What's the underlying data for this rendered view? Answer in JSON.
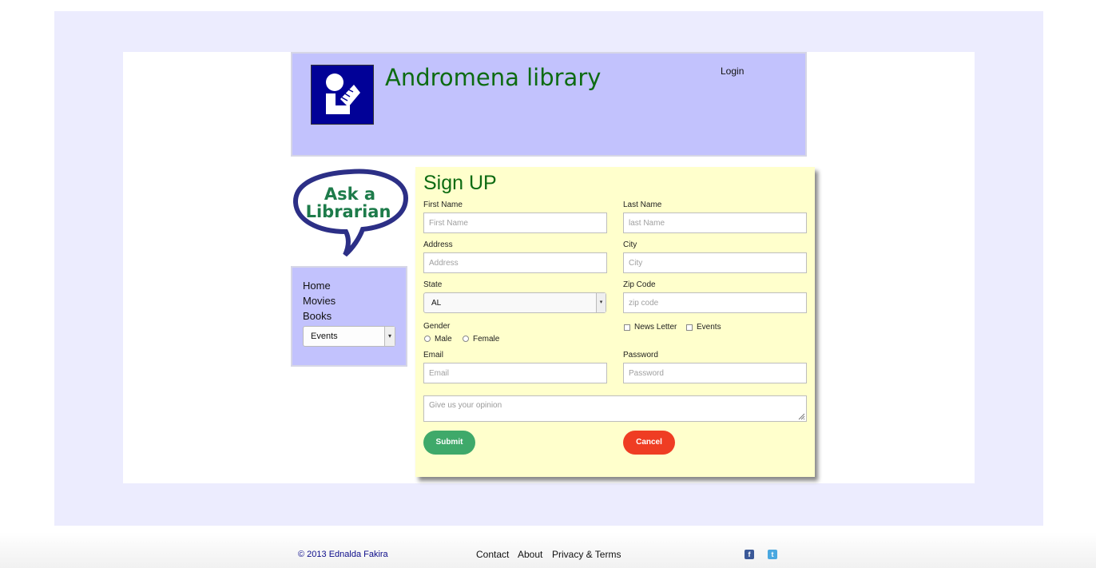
{
  "header": {
    "site_title": "Andromena library",
    "login_label": "Login",
    "logo_icon": "reading-person-icon"
  },
  "sidebar": {
    "ask_librarian": {
      "line1": "Ask a",
      "line2": "Librarian"
    },
    "nav_items": [
      {
        "label": "Home"
      },
      {
        "label": "Movies"
      },
      {
        "label": "Books"
      }
    ],
    "events_select": {
      "value": "Events"
    }
  },
  "form": {
    "title": "Sign UP",
    "first_name": {
      "label": "First Name",
      "placeholder": "First Name"
    },
    "last_name": {
      "label": "Last Name",
      "placeholder": "last Name"
    },
    "address": {
      "label": "Address",
      "placeholder": "Address"
    },
    "city": {
      "label": "City",
      "placeholder": "City"
    },
    "state": {
      "label": "State",
      "value": "AL"
    },
    "zip": {
      "label": "Zip Code",
      "placeholder": "zip code"
    },
    "gender": {
      "label": "Gender",
      "options": [
        "Male",
        "Female"
      ]
    },
    "subscriptions": [
      "News Letter",
      "Events"
    ],
    "email": {
      "label": "Email",
      "placeholder": "Email"
    },
    "password": {
      "label": "Password",
      "placeholder": "Password"
    },
    "opinion": {
      "placeholder": "Give us your opinion"
    },
    "submit_label": "Submit",
    "cancel_label": "Cancel"
  },
  "footer": {
    "copyright": "© 2013 Ednalda Fakira",
    "links": [
      "Contact",
      "About",
      "Privacy & Terms"
    ],
    "social": [
      {
        "icon": "facebook-icon",
        "glyph": "f"
      },
      {
        "icon": "twitter-icon",
        "glyph": "t"
      }
    ]
  },
  "colors": {
    "header_bg": "#c2c2fd",
    "title_green": "#0d6b12",
    "form_bg": "#ffffcc",
    "submit_green": "#3fa96a",
    "cancel_red": "#ef3d23",
    "logo_blue": "#010197"
  }
}
